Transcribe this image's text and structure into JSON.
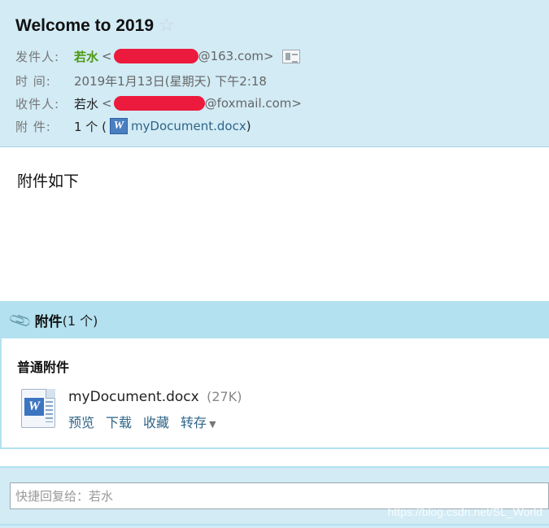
{
  "header": {
    "subject": "Welcome to 2019",
    "star_icon": "star-outline-icon",
    "from_label": "发件人:",
    "from_name": "若水",
    "from_addr_prefix": "<",
    "from_addr_suffix": "@163.com>",
    "time_label": "时 间:",
    "time_value": "2019年1月13日(星期天) 下午2:18",
    "to_label": "收件人:",
    "to_name": "若水",
    "to_addr_prefix": "<",
    "to_addr_suffix": "@foxmail.com>",
    "att_label": "附 件:",
    "att_count_prefix": "1 个 (",
    "att_file": "myDocument.docx",
    "att_count_suffix": ")"
  },
  "body": {
    "text": "附件如下"
  },
  "attachments": {
    "title": "附件",
    "count": "(1 个)",
    "group_title": "普通附件",
    "file": {
      "name": "myDocument.docx",
      "size": "(27K)"
    },
    "actions": {
      "preview": "预览",
      "download": "下载",
      "favorite": "收藏",
      "save_to": "转存"
    }
  },
  "reply": {
    "placeholder": "快捷回复给：若水"
  },
  "watermark": "https://blog.csdn.net/SL_World",
  "colors": {
    "header_bg": "#d2ebf5",
    "sender_name": "#4f9a14",
    "link": "#2f6588",
    "redaction": "#ec1a3c"
  }
}
